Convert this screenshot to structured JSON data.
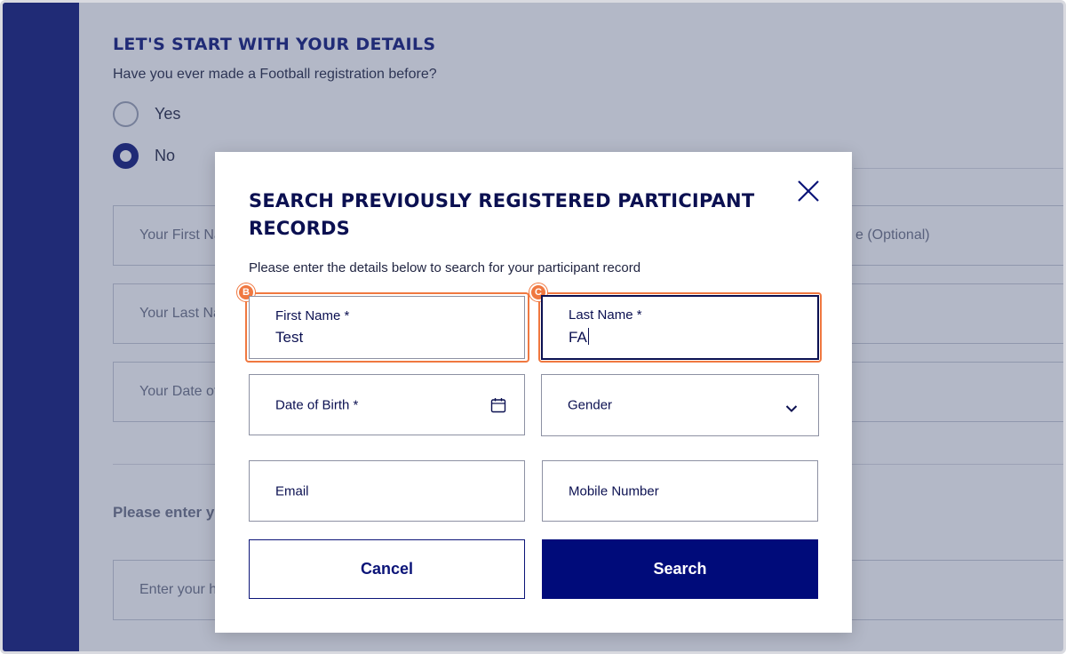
{
  "background": {
    "title": "LET'S START WITH YOUR DETAILS",
    "question": "Have you ever made a Football registration before?",
    "radio_options": [
      {
        "label": "Yes",
        "checked": false
      },
      {
        "label": "No",
        "checked": true
      }
    ],
    "fields": {
      "first_name": "Your First Na",
      "last_name": "Your Last Na",
      "dob": "Your Date of",
      "right_optional": "e (Optional)",
      "height": "Enter your he"
    },
    "enter_text": "Please enter y"
  },
  "modal": {
    "title": "SEARCH PREVIOUSLY REGISTERED PARTICIPANT RECORDS",
    "subtitle": "Please enter the details below to search for your participant record",
    "close_icon": "close-icon",
    "fields": {
      "first_name": {
        "label": "First Name *",
        "value": "Test",
        "marker": "B"
      },
      "last_name": {
        "label": "Last Name *",
        "value": "FA",
        "marker": "C"
      },
      "dob": {
        "label": "Date of Birth *",
        "icon": "calendar-icon"
      },
      "gender": {
        "label": "Gender",
        "icon": "chevron-down-icon"
      },
      "email": {
        "label": "Email"
      },
      "mobile": {
        "label": "Mobile Number"
      }
    },
    "buttons": {
      "cancel": "Cancel",
      "search": "Search"
    }
  },
  "colors": {
    "brand_navy": "#0b1478",
    "marker_orange": "#f07840",
    "search_button": "#000b7a"
  }
}
